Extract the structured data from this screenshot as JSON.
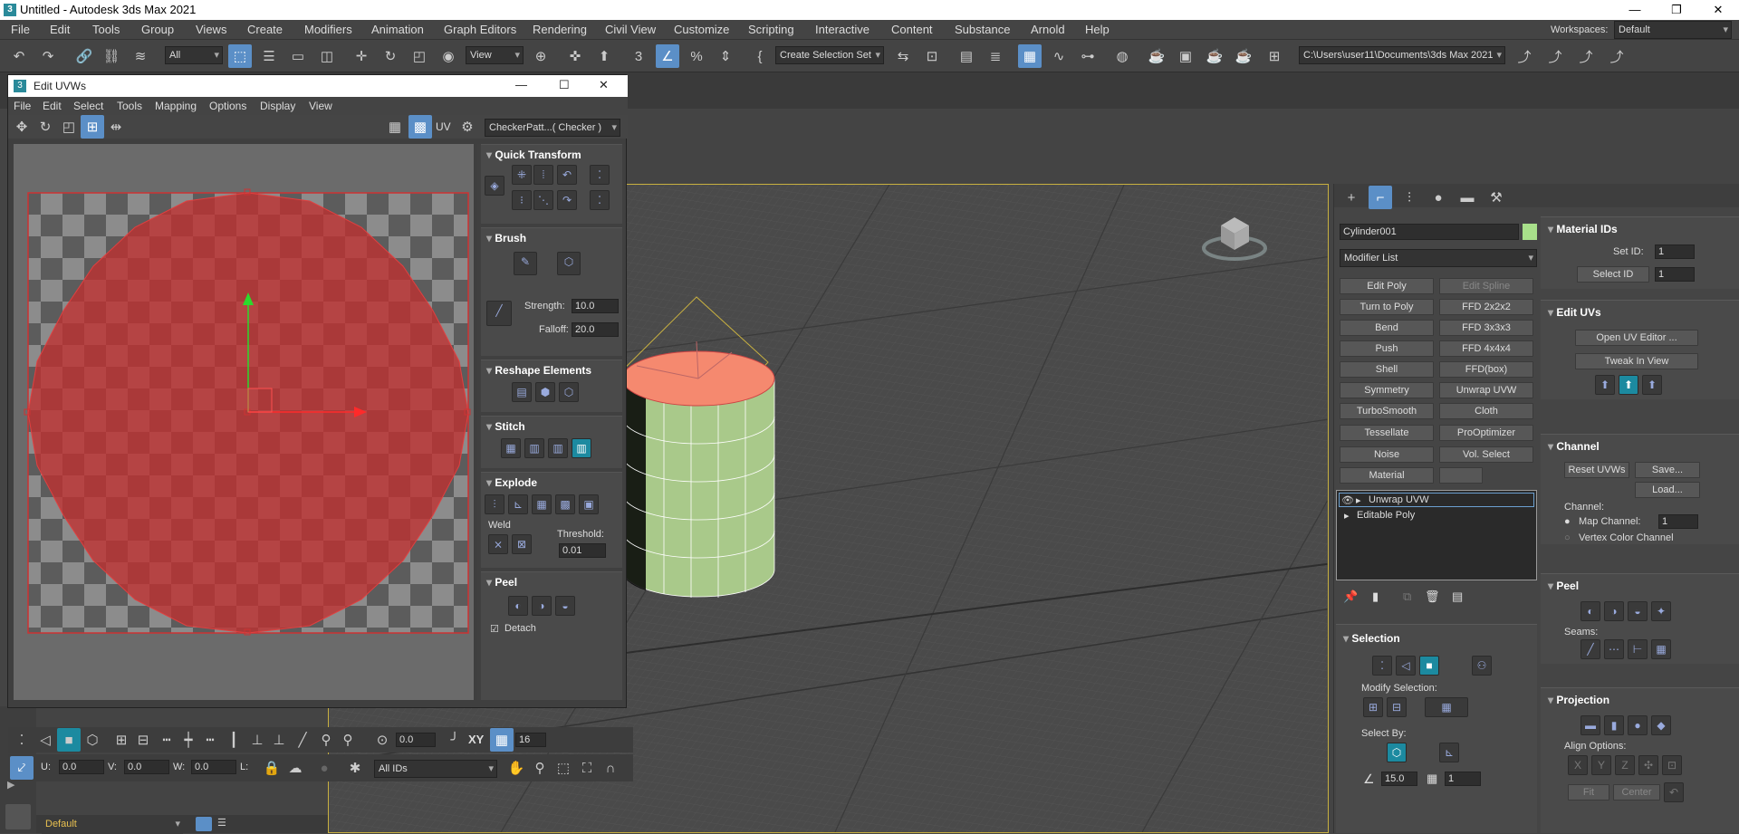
{
  "titlebar": {
    "title": "Untitled - Autodesk 3ds Max 2021",
    "min": "—",
    "max": "❐",
    "close": "✕"
  },
  "menubar": {
    "items": [
      "File",
      "Edit",
      "Tools",
      "Group",
      "Views",
      "Create",
      "Modifiers",
      "Animation",
      "Graph Editors",
      "Rendering",
      "Civil View",
      "Customize",
      "Scripting",
      "Interactive",
      "Content",
      "Substance",
      "Arnold",
      "Help"
    ],
    "workspaces_label": "Workspaces:",
    "workspaces_value": "Default"
  },
  "maintoolbar": {
    "selection_filter": "All",
    "ref_coord": "View",
    "named_selection": "Create Selection Set",
    "project_path": "C:\\Users\\user11\\Documents\\3ds Max 2021"
  },
  "uvw": {
    "title": "Edit UVWs",
    "menu": [
      "File",
      "Edit",
      "Select",
      "Tools",
      "Mapping",
      "Options",
      "Display",
      "View"
    ],
    "uv_label": "UV",
    "texture_dropdown": "CheckerPatt...( Checker )",
    "rollouts": {
      "quick_transform": "Quick Transform",
      "brush": "Brush",
      "strength_label": "Strength:",
      "strength": "10.0",
      "falloff_label": "Falloff:",
      "falloff": "20.0",
      "reshape": "Reshape Elements",
      "stitch": "Stitch",
      "explode": "Explode",
      "weld": "Weld",
      "threshold_label": "Threshold:",
      "threshold": "0.01",
      "peel": "Peel",
      "detach": "Detach"
    },
    "bottom": {
      "angle": "0.0",
      "xy": "XY",
      "snap_count": "16",
      "u_label": "U:",
      "u": "0.0",
      "v_label": "V:",
      "v": "0.0",
      "w_label": "W:",
      "w": "0.0",
      "l_label": "L:",
      "ids": "All IDs"
    }
  },
  "cmdpanel": {
    "object_name": "Cylinder001",
    "object_color": "#a8e08a",
    "modifier_list": "Modifier List",
    "modifier_buttons": [
      [
        "Edit Poly",
        "Edit Spline"
      ],
      [
        "Turn to Poly",
        "FFD 2x2x2"
      ],
      [
        "Bend",
        "FFD 3x3x3"
      ],
      [
        "Push",
        "FFD 4x4x4"
      ],
      [
        "Shell",
        "FFD(box)"
      ],
      [
        "Symmetry",
        "Unwrap UVW"
      ],
      [
        "TurboSmooth",
        "Cloth"
      ],
      [
        "Tessellate",
        "ProOptimizer"
      ],
      [
        "Noise",
        "Vol. Select"
      ],
      [
        "Material",
        ""
      ]
    ],
    "stack": [
      "Unwrap UVW",
      "Editable Poly"
    ],
    "selection": {
      "title": "Selection",
      "modify_selection": "Modify Selection:",
      "select_by": "Select By:",
      "angle": "15.0",
      "count": "1"
    },
    "material_ids": {
      "title": "Material IDs",
      "set_id_label": "Set ID:",
      "set_id": "1",
      "select_id": "Select ID",
      "select_value": "1"
    },
    "edit_uvs": {
      "title": "Edit UVs",
      "open_editor": "Open UV Editor ...",
      "tweak": "Tweak In View"
    },
    "channel": {
      "title": "Channel",
      "reset": "Reset UVWs",
      "save": "Save...",
      "load": "Load...",
      "channel_label": "Channel:",
      "map_channel": "Map Channel:",
      "map_value": "1",
      "vertex_color": "Vertex Color Channel"
    },
    "peel": {
      "title": "Peel",
      "seams": "Seams:"
    },
    "projection": {
      "title": "Projection",
      "align": "Align Options:",
      "x": "X",
      "y": "Y",
      "z": "Z",
      "fit": "Fit",
      "center": "Center"
    }
  },
  "bottom": {
    "layer": "Default"
  },
  "colors": {
    "accent": "#5b8fc7",
    "uv_fill": "#c0302f",
    "cap": "#f5896f",
    "cylinder": "#a9c98a"
  }
}
